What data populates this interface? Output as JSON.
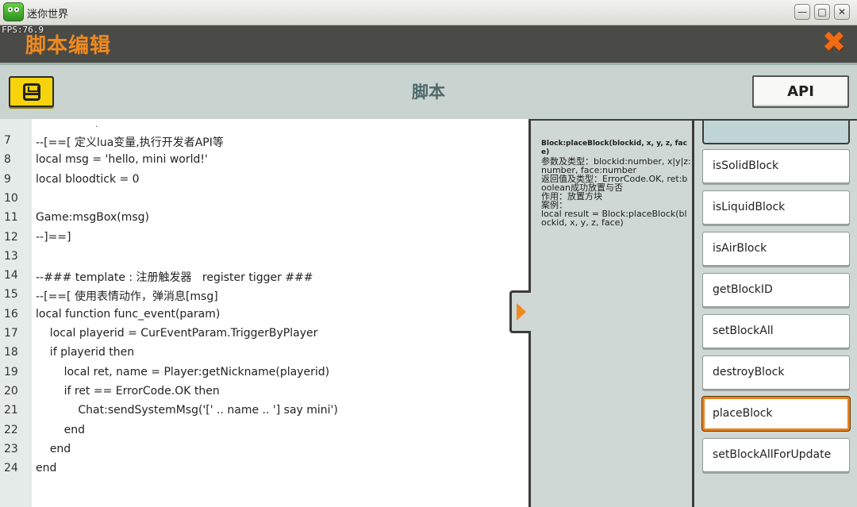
{
  "window": {
    "title": "迷你世界",
    "fps": "FPS:76.9",
    "minimize": "—",
    "maximize": "□",
    "close": "✕"
  },
  "editor": {
    "title": "脚本编辑",
    "close_icon": "✖",
    "save_icon": "floppy-disk-icon",
    "heading": "脚本",
    "api_button": "API"
  },
  "code": {
    "top_marker": ".",
    "lines": [
      {
        "num": "7",
        "text": "--[==[ 定义lua变量,执行开发者API等"
      },
      {
        "num": "8",
        "text": "local msg = 'hello, mini world!'"
      },
      {
        "num": "9",
        "text": "local bloodtick = 0"
      },
      {
        "num": "10",
        "text": ""
      },
      {
        "num": "11",
        "text": "Game:msgBox(msg)"
      },
      {
        "num": "12",
        "text": "--]==]"
      },
      {
        "num": "13",
        "text": ""
      },
      {
        "num": "14",
        "text": "--### template : 注册触发器   register tigger ###"
      },
      {
        "num": "15",
        "text": "--[==[ 使用表情动作，弹消息[msg]"
      },
      {
        "num": "16",
        "text": "local function func_event(param)"
      },
      {
        "num": "17",
        "text": "    local playerid = CurEventParam.TriggerByPlayer"
      },
      {
        "num": "18",
        "text": "    if playerid then"
      },
      {
        "num": "19",
        "text": "        local ret, name = Player:getNickname(playerid)"
      },
      {
        "num": "20",
        "text": "        if ret == ErrorCode.OK then"
      },
      {
        "num": "21",
        "text": "            Chat:sendSystemMsg('[' .. name .. '] say mini')"
      },
      {
        "num": "22",
        "text": "        end"
      },
      {
        "num": "23",
        "text": "    end"
      },
      {
        "num": "24",
        "text": "end"
      }
    ]
  },
  "description": {
    "signature": "Block:placeBlock(blockid, x, y, z, face)",
    "params": "参数及类型：blockid:number, x|y|z:number, face:number",
    "returns": "返回值及类型：ErrorCode.OK, ret:boolean成功放置与否",
    "purpose": "作用：放置方块",
    "example_label": "案例：",
    "example": "local result = Block:placeBlock(blockid, x, y, z, face)"
  },
  "api_list": {
    "items": [
      {
        "label": "isSolidBlock",
        "selected": false
      },
      {
        "label": "isLiquidBlock",
        "selected": false
      },
      {
        "label": "isAirBlock",
        "selected": false
      },
      {
        "label": "getBlockID",
        "selected": false
      },
      {
        "label": "setBlockAll",
        "selected": false
      },
      {
        "label": "destroyBlock",
        "selected": false
      },
      {
        "label": "placeBlock",
        "selected": true
      },
      {
        "label": "setBlockAllForUpdate",
        "selected": false
      }
    ]
  },
  "colors": {
    "accent": "#f08a1e",
    "save_button": "#f6d30a",
    "header_bg": "#4a4a46",
    "panel_bg": "#cfd8d5"
  }
}
